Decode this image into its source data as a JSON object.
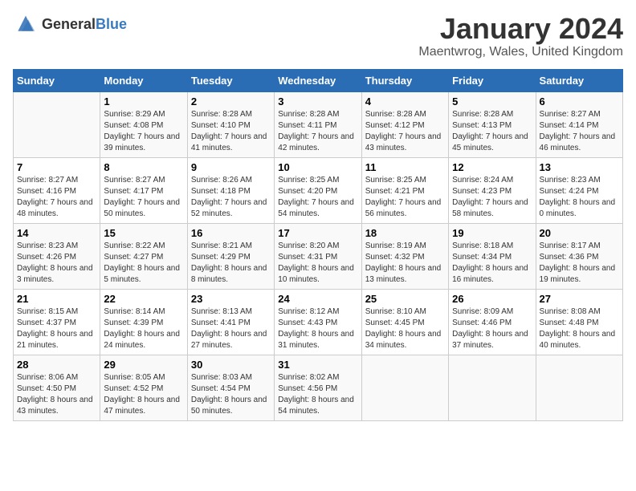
{
  "header": {
    "logo_general": "General",
    "logo_blue": "Blue",
    "title": "January 2024",
    "location": "Maentwrog, Wales, United Kingdom"
  },
  "days_of_week": [
    "Sunday",
    "Monday",
    "Tuesday",
    "Wednesday",
    "Thursday",
    "Friday",
    "Saturday"
  ],
  "weeks": [
    [
      {
        "day": "",
        "sunrise": "",
        "sunset": "",
        "daylight": ""
      },
      {
        "day": "1",
        "sunrise": "Sunrise: 8:29 AM",
        "sunset": "Sunset: 4:08 PM",
        "daylight": "Daylight: 7 hours and 39 minutes."
      },
      {
        "day": "2",
        "sunrise": "Sunrise: 8:28 AM",
        "sunset": "Sunset: 4:10 PM",
        "daylight": "Daylight: 7 hours and 41 minutes."
      },
      {
        "day": "3",
        "sunrise": "Sunrise: 8:28 AM",
        "sunset": "Sunset: 4:11 PM",
        "daylight": "Daylight: 7 hours and 42 minutes."
      },
      {
        "day": "4",
        "sunrise": "Sunrise: 8:28 AM",
        "sunset": "Sunset: 4:12 PM",
        "daylight": "Daylight: 7 hours and 43 minutes."
      },
      {
        "day": "5",
        "sunrise": "Sunrise: 8:28 AM",
        "sunset": "Sunset: 4:13 PM",
        "daylight": "Daylight: 7 hours and 45 minutes."
      },
      {
        "day": "6",
        "sunrise": "Sunrise: 8:27 AM",
        "sunset": "Sunset: 4:14 PM",
        "daylight": "Daylight: 7 hours and 46 minutes."
      }
    ],
    [
      {
        "day": "7",
        "sunrise": "Sunrise: 8:27 AM",
        "sunset": "Sunset: 4:16 PM",
        "daylight": "Daylight: 7 hours and 48 minutes."
      },
      {
        "day": "8",
        "sunrise": "Sunrise: 8:27 AM",
        "sunset": "Sunset: 4:17 PM",
        "daylight": "Daylight: 7 hours and 50 minutes."
      },
      {
        "day": "9",
        "sunrise": "Sunrise: 8:26 AM",
        "sunset": "Sunset: 4:18 PM",
        "daylight": "Daylight: 7 hours and 52 minutes."
      },
      {
        "day": "10",
        "sunrise": "Sunrise: 8:25 AM",
        "sunset": "Sunset: 4:20 PM",
        "daylight": "Daylight: 7 hours and 54 minutes."
      },
      {
        "day": "11",
        "sunrise": "Sunrise: 8:25 AM",
        "sunset": "Sunset: 4:21 PM",
        "daylight": "Daylight: 7 hours and 56 minutes."
      },
      {
        "day": "12",
        "sunrise": "Sunrise: 8:24 AM",
        "sunset": "Sunset: 4:23 PM",
        "daylight": "Daylight: 7 hours and 58 minutes."
      },
      {
        "day": "13",
        "sunrise": "Sunrise: 8:23 AM",
        "sunset": "Sunset: 4:24 PM",
        "daylight": "Daylight: 8 hours and 0 minutes."
      }
    ],
    [
      {
        "day": "14",
        "sunrise": "Sunrise: 8:23 AM",
        "sunset": "Sunset: 4:26 PM",
        "daylight": "Daylight: 8 hours and 3 minutes."
      },
      {
        "day": "15",
        "sunrise": "Sunrise: 8:22 AM",
        "sunset": "Sunset: 4:27 PM",
        "daylight": "Daylight: 8 hours and 5 minutes."
      },
      {
        "day": "16",
        "sunrise": "Sunrise: 8:21 AM",
        "sunset": "Sunset: 4:29 PM",
        "daylight": "Daylight: 8 hours and 8 minutes."
      },
      {
        "day": "17",
        "sunrise": "Sunrise: 8:20 AM",
        "sunset": "Sunset: 4:31 PM",
        "daylight": "Daylight: 8 hours and 10 minutes."
      },
      {
        "day": "18",
        "sunrise": "Sunrise: 8:19 AM",
        "sunset": "Sunset: 4:32 PM",
        "daylight": "Daylight: 8 hours and 13 minutes."
      },
      {
        "day": "19",
        "sunrise": "Sunrise: 8:18 AM",
        "sunset": "Sunset: 4:34 PM",
        "daylight": "Daylight: 8 hours and 16 minutes."
      },
      {
        "day": "20",
        "sunrise": "Sunrise: 8:17 AM",
        "sunset": "Sunset: 4:36 PM",
        "daylight": "Daylight: 8 hours and 19 minutes."
      }
    ],
    [
      {
        "day": "21",
        "sunrise": "Sunrise: 8:15 AM",
        "sunset": "Sunset: 4:37 PM",
        "daylight": "Daylight: 8 hours and 21 minutes."
      },
      {
        "day": "22",
        "sunrise": "Sunrise: 8:14 AM",
        "sunset": "Sunset: 4:39 PM",
        "daylight": "Daylight: 8 hours and 24 minutes."
      },
      {
        "day": "23",
        "sunrise": "Sunrise: 8:13 AM",
        "sunset": "Sunset: 4:41 PM",
        "daylight": "Daylight: 8 hours and 27 minutes."
      },
      {
        "day": "24",
        "sunrise": "Sunrise: 8:12 AM",
        "sunset": "Sunset: 4:43 PM",
        "daylight": "Daylight: 8 hours and 31 minutes."
      },
      {
        "day": "25",
        "sunrise": "Sunrise: 8:10 AM",
        "sunset": "Sunset: 4:45 PM",
        "daylight": "Daylight: 8 hours and 34 minutes."
      },
      {
        "day": "26",
        "sunrise": "Sunrise: 8:09 AM",
        "sunset": "Sunset: 4:46 PM",
        "daylight": "Daylight: 8 hours and 37 minutes."
      },
      {
        "day": "27",
        "sunrise": "Sunrise: 8:08 AM",
        "sunset": "Sunset: 4:48 PM",
        "daylight": "Daylight: 8 hours and 40 minutes."
      }
    ],
    [
      {
        "day": "28",
        "sunrise": "Sunrise: 8:06 AM",
        "sunset": "Sunset: 4:50 PM",
        "daylight": "Daylight: 8 hours and 43 minutes."
      },
      {
        "day": "29",
        "sunrise": "Sunrise: 8:05 AM",
        "sunset": "Sunset: 4:52 PM",
        "daylight": "Daylight: 8 hours and 47 minutes."
      },
      {
        "day": "30",
        "sunrise": "Sunrise: 8:03 AM",
        "sunset": "Sunset: 4:54 PM",
        "daylight": "Daylight: 8 hours and 50 minutes."
      },
      {
        "day": "31",
        "sunrise": "Sunrise: 8:02 AM",
        "sunset": "Sunset: 4:56 PM",
        "daylight": "Daylight: 8 hours and 54 minutes."
      },
      {
        "day": "",
        "sunrise": "",
        "sunset": "",
        "daylight": ""
      },
      {
        "day": "",
        "sunrise": "",
        "sunset": "",
        "daylight": ""
      },
      {
        "day": "",
        "sunrise": "",
        "sunset": "",
        "daylight": ""
      }
    ]
  ]
}
